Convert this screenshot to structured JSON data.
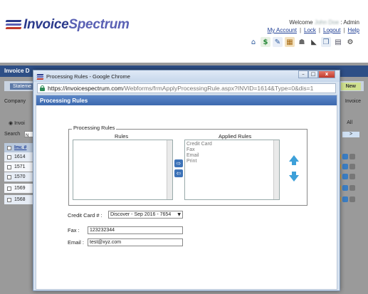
{
  "app": {
    "logo": {
      "part1": "Invoice",
      "part2": "Spectrum",
      "colors": [
        "#2b3a8c",
        "#5a61b4",
        "#c0392b"
      ]
    },
    "welcome": {
      "prefix": "Welcome",
      "name": "John Doe",
      "suffix": ": Admin"
    },
    "links": [
      "My Account",
      "Lock",
      "Logout",
      "Help"
    ],
    "toolbar_icons": [
      "home-icon",
      "invoice-dollar-icon",
      "edit-document-icon",
      "products-icon",
      "users-icon",
      "tag-icon",
      "copy-icon",
      "documents-icon",
      "settings-icon"
    ],
    "background": {
      "header": "Invoice D",
      "tab": "Stateme",
      "new_button": "New",
      "company_label": "Company",
      "invoice_label": "Invoice",
      "radio_label": "Invoi",
      "all_label": "All",
      "search_label": "Search",
      "search_value": "N",
      "nav_arrow": ">",
      "table_header": "Inv. #",
      "rows": [
        "1614",
        "1571",
        "1570",
        "1569",
        "1568"
      ]
    }
  },
  "popup": {
    "window_title": "Processing Rules - Google Chrome",
    "window_buttons": {
      "minimize": "–",
      "maximize": "□",
      "close": "x"
    },
    "url": {
      "host": "https://invoicespectrum.com",
      "path": "/Webforms/frmApplyProcessingRule.aspx?INVID=1614&Type=0&dis=1"
    },
    "panel_title": "Processing Rules",
    "group_legend": "Processing Rules",
    "rules_label": "Rules",
    "applied_label": "Applied Rules",
    "rules": [],
    "applied_rules": [
      "Credit Card",
      "Fax",
      "Email",
      "Print"
    ],
    "move_right": "⇨",
    "move_left": "⇦",
    "credit_card": {
      "label": "Credit Card # :",
      "selected": "Discover - Sep 2016 - 7654"
    },
    "fax": {
      "label": "Fax :",
      "value": "123232344"
    },
    "email": {
      "label": "Email :",
      "value": "test@xyz.com"
    }
  }
}
